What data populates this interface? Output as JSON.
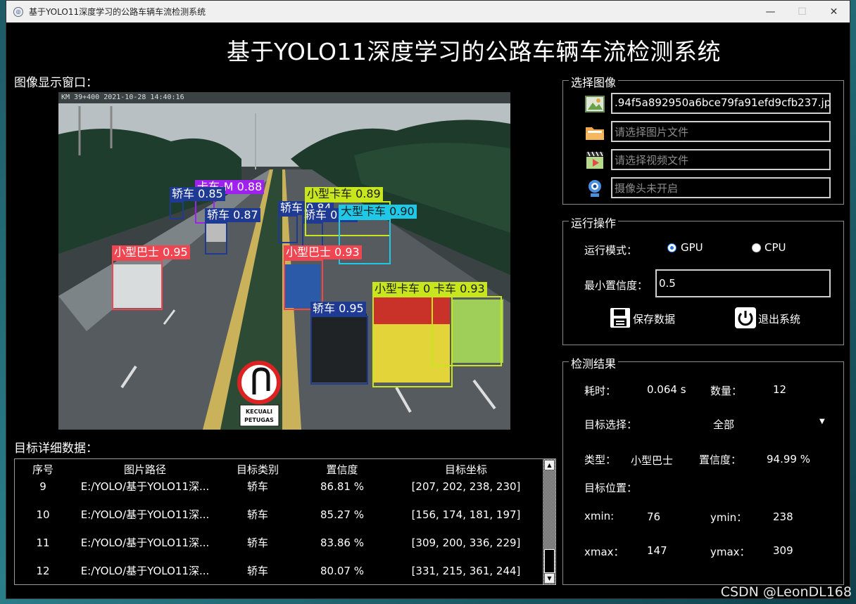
{
  "window": {
    "title": "基于YOLO11深度学习的公路车辆车流检测系统"
  },
  "header": {
    "title": "基于YOLO11深度学习的公路车辆车流检测系统"
  },
  "image_panel": {
    "label": "图像显示窗口：",
    "timestamp": "KM 39+400  2021-10-28  14:40:16",
    "detections": [
      {
        "label": "卡车-M 0.88",
        "color": "#a020f0"
      },
      {
        "label": "轿车 0.85",
        "color": "#1f3a93"
      },
      {
        "label": "轿车 0.87",
        "color": "#1f3a93"
      },
      {
        "label": "轿车 0.84",
        "color": "#1f3a93"
      },
      {
        "label": "轿车 0.80",
        "color": "#1f3a93"
      },
      {
        "label": "小型卡车 0.89",
        "color": "#c8e61e"
      },
      {
        "label": "大型卡车 0.90",
        "color": "#1ec8e6"
      },
      {
        "label": "小型巴士 0.95",
        "color": "#f04652"
      },
      {
        "label": "小型巴士 0.93",
        "color": "#f04652"
      },
      {
        "label": "小型卡车 0.94",
        "color": "#c8e61e"
      },
      {
        "label": "卡车 0.93",
        "color": "#c8e61e"
      },
      {
        "label": "轿车 0.95",
        "color": "#1f3a93"
      }
    ],
    "road_sign": {
      "line1": "KECUALI",
      "line2": "PETUGAS"
    }
  },
  "select_image": {
    "title": "选择图像",
    "image_path": ".94f5a892950a6bce79fa91efd9cfb237.jpg",
    "image_placeholder": "请选择图片文件",
    "video_placeholder": "请选择视频文件",
    "camera_placeholder": "摄像头未开启"
  },
  "operation": {
    "title": "运行操作",
    "mode_label": "运行模式：",
    "gpu_label": "GPU",
    "cpu_label": "CPU",
    "selected_mode": "GPU",
    "min_conf_label": "最小置信度：",
    "min_conf_value": "0.5",
    "save_label": "保存数据",
    "exit_label": "退出系统"
  },
  "results": {
    "title": "检测结果",
    "time_label": "耗时：",
    "time_value": "0.064 s",
    "count_label": "数量：",
    "count_value": "12",
    "target_select_label": "目标选择：",
    "target_select_value": "全部",
    "type_label": "类型：",
    "type_value": "小型巴士",
    "conf_label": "置信度：",
    "conf_value": "94.99 %",
    "position_label": "目标位置：",
    "xmin_label": "xmin:",
    "xmin_value": "76",
    "ymin_label": "ymin：",
    "ymin_value": "238",
    "xmax_label": "xmax：",
    "xmax_value": "147",
    "ymax_label": "ymax：",
    "ymax_value": "309"
  },
  "table": {
    "label": "目标详细数据：",
    "headers": [
      "序号",
      "图片路径",
      "目标类别",
      "置信度",
      "目标坐标"
    ],
    "rows": [
      [
        "9",
        "E:/YOLO/基于YOLO11深...",
        "轿车",
        "86.81 %",
        "[207, 202, 238, 230]"
      ],
      [
        "10",
        "E:/YOLO/基于YOLO11深...",
        "轿车",
        "85.27 %",
        "[156, 174, 181, 197]"
      ],
      [
        "11",
        "E:/YOLO/基于YOLO11深...",
        "轿车",
        "83.86 %",
        "[309, 200, 336, 229]"
      ],
      [
        "12",
        "E:/YOLO/基于YOLO11深...",
        "轿车",
        "80.07 %",
        "[331, 215, 361, 244]"
      ]
    ]
  },
  "watermark": "CSDN @LeonDL168",
  "colors": {
    "background": "#000000",
    "text": "#ffffff",
    "accent": "#1a73e8"
  }
}
